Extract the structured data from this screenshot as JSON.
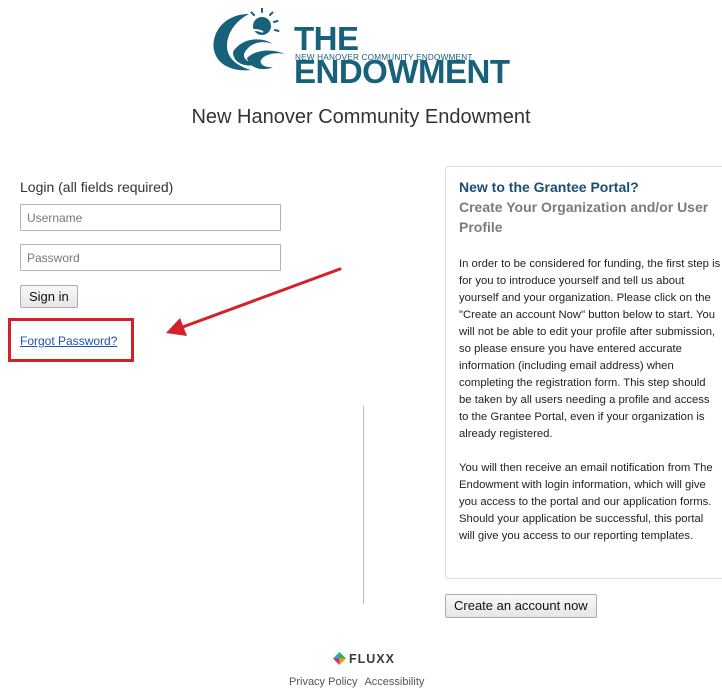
{
  "logo": {
    "title": "THE ENDOWMENT",
    "subtitle": "NEW HANOVER COMMUNITY ENDOWMENT",
    "color": "#17617a"
  },
  "heading": "New Hanover Community Endowment",
  "login": {
    "label": "Login (all fields required)",
    "username_placeholder": "Username",
    "password_placeholder": "Password",
    "signin_label": "Sign in",
    "forgot_label": "Forgot Password?"
  },
  "panel": {
    "title": "New to the Grantee Portal?",
    "subtitle": "Create Your Organization and/or User Profile",
    "paragraph1": "In order to be considered for funding, the first step is for you to introduce yourself and tell us about yourself and your organization. Please click on the \"Create an account Now\" button below to start. You will not be able to edit your profile after submission, so please ensure you have entered accurate information (including email address) when completing the registration form. This step should be taken by all users needing a profile and access to the Grantee Portal, even if your organization is already registered.",
    "paragraph2": "You will then receive an email notification from The Endowment with login information, which will give you access to the portal and our application forms. Should your application be successful, this portal will give you access to our reporting templates.",
    "create_label": "Create an account now"
  },
  "footer": {
    "brand": "FLUXX",
    "privacy_label": "Privacy Policy",
    "accessibility_label": "Accessibility"
  },
  "colors": {
    "annotation": "#d5202a",
    "link": "#1a55b5",
    "panel_title": "#1b4f6e"
  }
}
